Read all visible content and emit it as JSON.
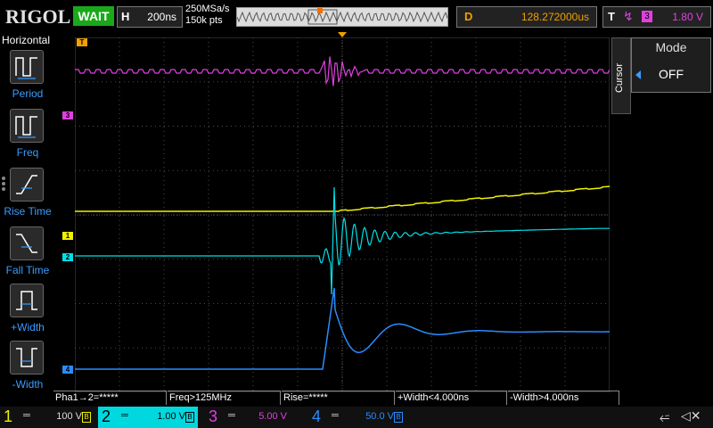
{
  "topbar": {
    "brand": "RIGOL",
    "run_status": "WAIT",
    "horizontal_label": "H",
    "timebase": "200ns",
    "sample_rate": "250MSa/s",
    "memory_depth": "150k pts",
    "delay_label": "D",
    "delay_value": "128.272000us",
    "trigger_label": "T",
    "trigger_edge": "↯",
    "trigger_source": "3",
    "trigger_level": "1.80 V"
  },
  "left_menu": {
    "title": "Horizontal",
    "items": [
      {
        "label": "Period"
      },
      {
        "label": "Freq"
      },
      {
        "label": "Rise Time"
      },
      {
        "label": "Fall Time"
      },
      {
        "label": "+Width"
      },
      {
        "label": "-Width"
      }
    ]
  },
  "right_panel": {
    "tab_label": "Cursor",
    "mode_title": "Mode",
    "mode_value": "OFF"
  },
  "measurements": [
    {
      "text": "Pha1→2=*****"
    },
    {
      "text": "Freq>125MHz"
    },
    {
      "text": "Rise=*****"
    },
    {
      "text": "+Width<4.000ns"
    },
    {
      "text": "-Width>4.000ns"
    }
  ],
  "channels": [
    {
      "num": "1",
      "value": "100 V",
      "color": "#f0f000",
      "coupling": "═"
    },
    {
      "num": "2",
      "value": "1.00 V",
      "color": "#00e0e8",
      "coupling": "═"
    },
    {
      "num": "3",
      "value": "5.00 V",
      "color": "#e040e0",
      "coupling": "═"
    },
    {
      "num": "4",
      "value": "50.0 V",
      "color": "#2a8cff",
      "coupling": "═"
    }
  ],
  "status_icons": [
    "usb-icon",
    "speaker-muted-icon"
  ],
  "colors": {
    "ch1": "#f0f000",
    "ch2": "#00e0e8",
    "ch3": "#e040e0",
    "ch4": "#2a8cff",
    "trigger": "#f0a000",
    "menu_accent": "#3a9cff"
  }
}
